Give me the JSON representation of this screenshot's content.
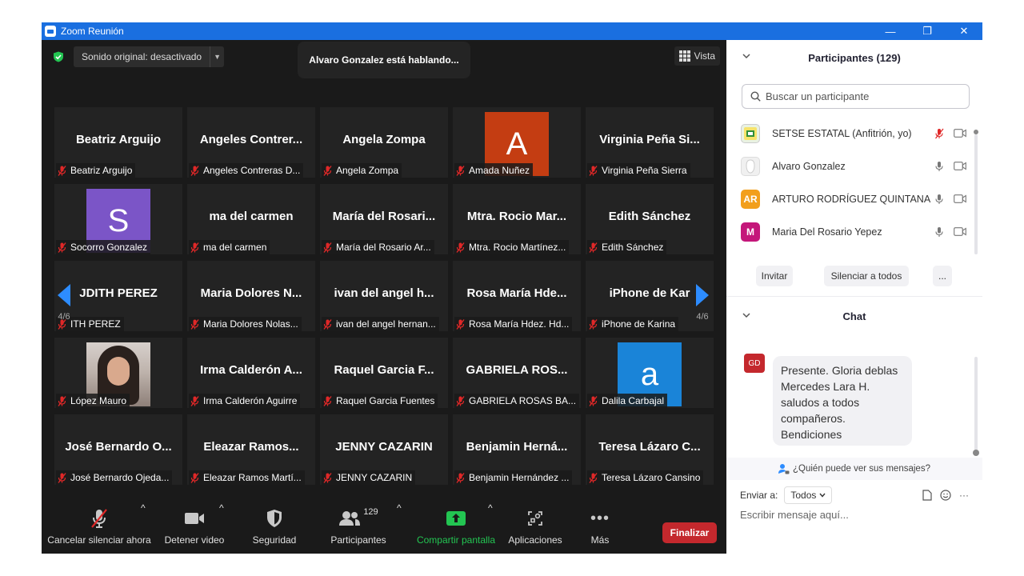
{
  "window": {
    "title": "Zoom Reunión",
    "controls": [
      "—",
      "❐",
      "✕"
    ]
  },
  "meeting": {
    "audio_label": "Sonido original: desactivado",
    "speaking": "Alvaro Gonzalez está hablando...",
    "view_label": "Vista",
    "page_left": "4/6",
    "page_right": "4/6"
  },
  "tiles": [
    {
      "name": "Beatriz Arguijo",
      "label": "Beatriz Arguijo",
      "kind": "text"
    },
    {
      "name": "Angeles  Contrer...",
      "label": "Angeles Contreras D...",
      "kind": "text"
    },
    {
      "name": "Angela Zompa",
      "label": "Angela Zompa",
      "kind": "text"
    },
    {
      "name": "A",
      "label": "Amada Nuñez",
      "kind": "avatar",
      "color": "#c43d12"
    },
    {
      "name": "Virginia  Peña  Si...",
      "label": "Virginia Peña Sierra",
      "kind": "text"
    },
    {
      "name": "S",
      "label": "Socorro Gonzalez",
      "kind": "avatar",
      "color": "#7b55c7"
    },
    {
      "name": "ma del carmen",
      "label": "ma del carmen",
      "kind": "text"
    },
    {
      "name": "María  del  Rosari...",
      "label": "María del Rosario Ar...",
      "kind": "text"
    },
    {
      "name": "Mtra.  Rocio  Mar...",
      "label": "Mtra. Rocio Martínez...",
      "kind": "text"
    },
    {
      "name": "Edith Sánchez",
      "label": "Edith Sánchez",
      "kind": "text"
    },
    {
      "name": "JDITH PEREZ",
      "label": "ITH PEREZ",
      "kind": "text"
    },
    {
      "name": "Maria  Dolores  N...",
      "label": "Maria Dolores Nolas...",
      "kind": "text"
    },
    {
      "name": "ivan  del  angel  h...",
      "label": "ivan del angel hernan...",
      "kind": "text"
    },
    {
      "name": "Rosa  María  Hde...",
      "label": "Rosa María Hdez. Hd...",
      "kind": "text"
    },
    {
      "name": "iPhone  de  Kar",
      "label": "iPhone de Karina",
      "kind": "text"
    },
    {
      "name": "",
      "label": "López Mauro",
      "kind": "photo"
    },
    {
      "name": "Irma  Calderón  A...",
      "label": "Irma Calderón Aguirre",
      "kind": "text"
    },
    {
      "name": "Raquel  Garcia  F...",
      "label": "Raquel Garcia Fuentes",
      "kind": "text"
    },
    {
      "name": "GABRIELA  ROS...",
      "label": "GABRIELA ROSAS BA...",
      "kind": "text"
    },
    {
      "name": "a",
      "label": "Dalila Carbajal",
      "kind": "avatar",
      "color": "#1a84d8"
    },
    {
      "name": "José  Bernardo  O...",
      "label": "José Bernardo Ojeda...",
      "kind": "text"
    },
    {
      "name": "Eleazar  Ramos...",
      "label": "Eleazar Ramos Martí...",
      "kind": "text"
    },
    {
      "name": "JENNY CAZARIN",
      "label": "JENNY CAZARIN",
      "kind": "text"
    },
    {
      "name": "Benjamin  Herná...",
      "label": "Benjamin Hernández ...",
      "kind": "text"
    },
    {
      "name": "Teresa  Lázaro  C...",
      "label": "Teresa Lázaro Cansino",
      "kind": "text"
    }
  ],
  "toolbar": {
    "unmute": "Cancelar silenciar ahora",
    "video": "Detener video",
    "security": "Seguridad",
    "participants": "Participantes",
    "participants_count": "129",
    "share": "Compartir pantalla",
    "apps": "Aplicaciones",
    "more": "Más",
    "end": "Finalizar"
  },
  "participants_panel": {
    "title": "Participantes (129)",
    "search_placeholder": "Buscar un participante",
    "list": [
      {
        "name": "SETSE ESTATAL (Anfitrión, yo)",
        "avatar": "logo",
        "color": "#e9f2e2",
        "mic": "off"
      },
      {
        "name": "Alvaro Gonzalez",
        "avatar": "blank",
        "color": "#f0f0f0",
        "mic": "on"
      },
      {
        "name": "ARTURO RODRÍGUEZ QUINTANA",
        "avatar": "AR",
        "color": "#f29f1c",
        "mic": "on"
      },
      {
        "name": "Maria Del Rosario Yepez",
        "avatar": "M",
        "color": "#c4177a",
        "mic": "on"
      }
    ],
    "invite": "Invitar",
    "mute_all": "Silenciar a todos",
    "more": "..."
  },
  "chat": {
    "title": "Chat",
    "avatar": "GD",
    "message": "Presente. Gloria deblas Mercedes Lara H. saludos a todos compañeros. Bendiciones",
    "who_can_see": "¿Quién puede ver sus mensajes?",
    "send_to_label": "Enviar a:",
    "send_to_value": "Todos",
    "input_placeholder": "Escribir mensaje aquí..."
  },
  "colors": {
    "titlebar": "#1a6fe0",
    "end": "#c4282d",
    "share": "#23c552",
    "mic_off": "#e02828"
  }
}
